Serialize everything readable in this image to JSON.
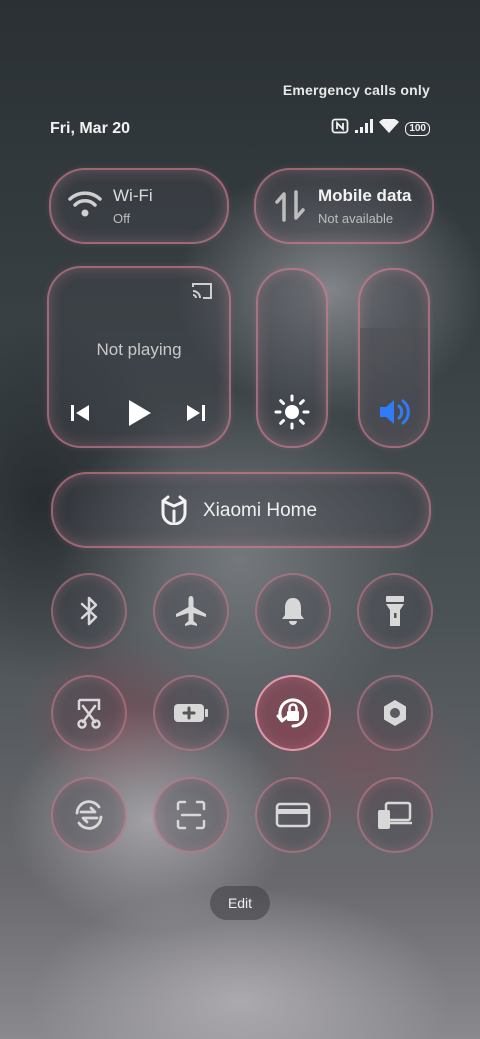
{
  "status_bar": {
    "network_status": "Emergency calls only",
    "date": "Fri, Mar 20",
    "battery": "100",
    "icons": [
      "nfc-icon",
      "signal-icon",
      "wifi-icon",
      "battery-icon"
    ]
  },
  "wifi_tile": {
    "title": "Wi-Fi",
    "status": "Off",
    "icon": "wifi-icon"
  },
  "data_tile": {
    "title": "Mobile data",
    "status": "Not available",
    "icon": "mobile-data-icon"
  },
  "media": {
    "status": "Not playing",
    "icons": [
      "cast-icon",
      "previous-icon",
      "play-icon",
      "next-icon"
    ]
  },
  "brightness": {
    "icon": "brightness-icon",
    "level": 0
  },
  "volume": {
    "icon": "volume-icon",
    "level": 0.67
  },
  "home_tile": {
    "label": "Xiaomi Home",
    "icon": "xiaomi-home-icon"
  },
  "toggles": [
    {
      "icon": "bluetooth-icon",
      "active": false
    },
    {
      "icon": "airplane-icon",
      "active": false
    },
    {
      "icon": "bell-icon",
      "active": false
    },
    {
      "icon": "flashlight-icon",
      "active": false
    },
    {
      "icon": "screenshot-icon",
      "active": false
    },
    {
      "icon": "battery-saver-icon",
      "active": false
    },
    {
      "icon": "rotation-lock-icon",
      "active": true
    },
    {
      "icon": "settings-icon",
      "active": false
    },
    {
      "icon": "sync-icon",
      "active": false
    },
    {
      "icon": "scanner-icon",
      "active": false
    },
    {
      "icon": "card-icon",
      "active": false
    },
    {
      "icon": "cast-screen-icon",
      "active": false
    }
  ],
  "edit_label": "Edit",
  "colors": {
    "accent_blue": "#2f7cf6",
    "tile_border": "#f08ca0"
  }
}
